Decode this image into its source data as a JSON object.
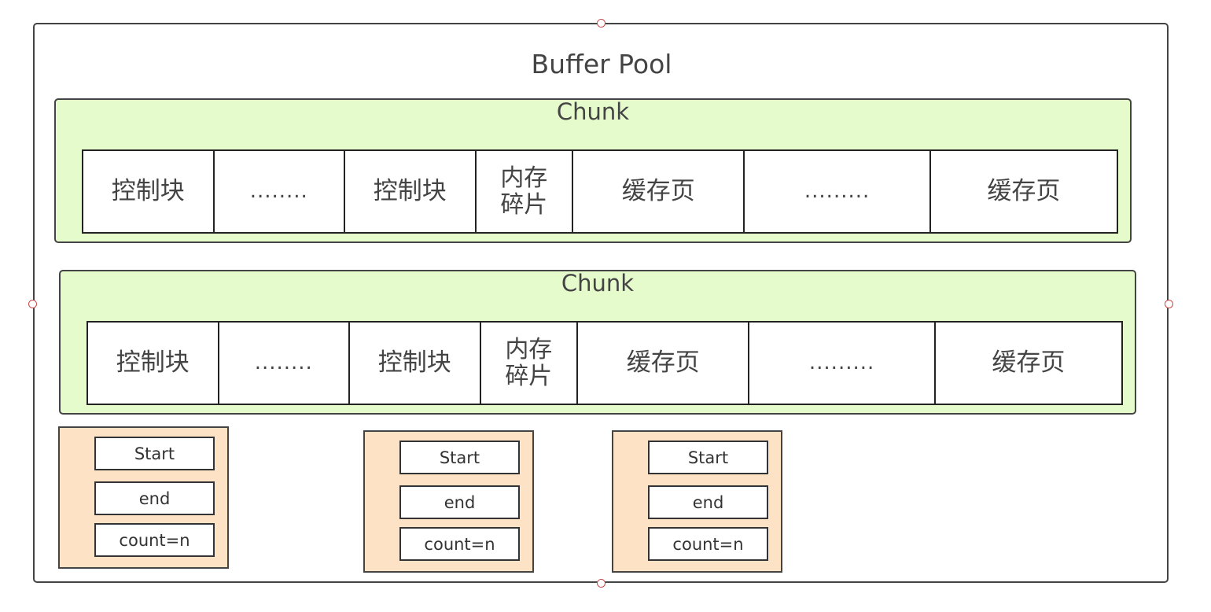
{
  "title": "Buffer Pool",
  "chunks": [
    {
      "title": "Chunk",
      "cells": [
        "控制块",
        "........",
        "控制块",
        "内存\n碎片",
        "缓存页",
        ".........",
        "缓存页"
      ]
    },
    {
      "title": "Chunk",
      "cells": [
        "控制块",
        "........",
        "控制块",
        "内存\n碎片",
        "缓存页",
        ".........",
        "缓存页"
      ]
    }
  ],
  "free_nodes": [
    {
      "start": "Start",
      "end": "end",
      "count": "count=n"
    },
    {
      "start": "Start",
      "end": "end",
      "count": "count=n"
    },
    {
      "start": "Start",
      "end": "end",
      "count": "count=n"
    }
  ],
  "colors": {
    "chunk_fill": "#e6fbcc",
    "node_fill": "#fde2c6",
    "handle_stroke": "#c84a4a",
    "border": "#444444"
  }
}
